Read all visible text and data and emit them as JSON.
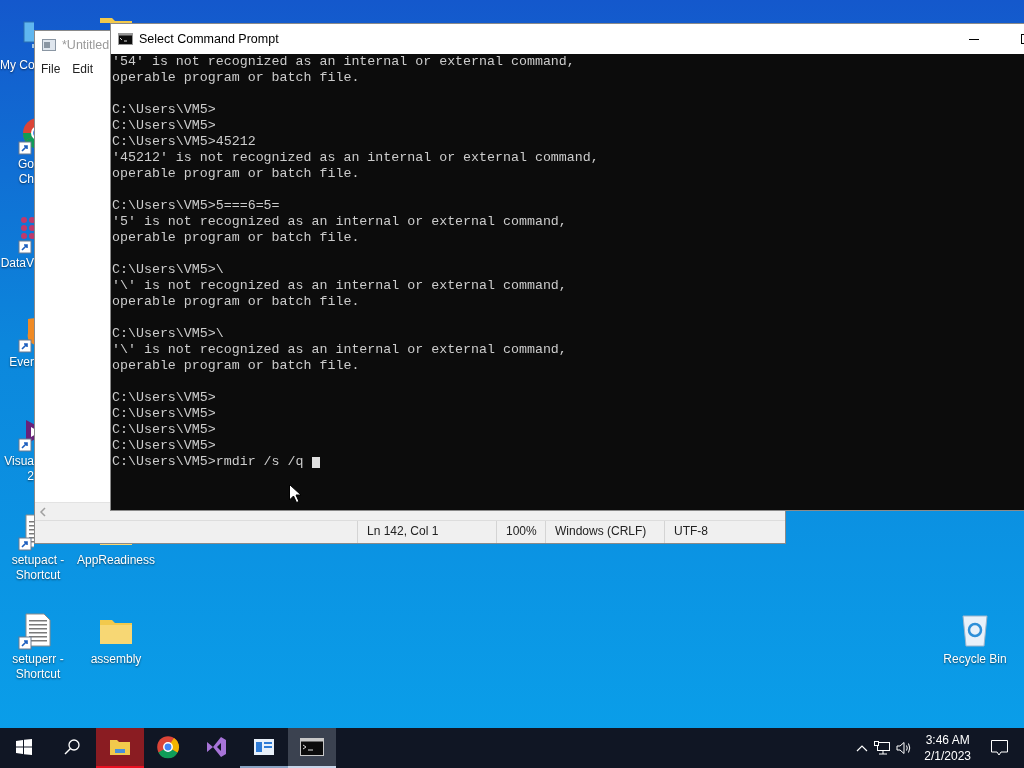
{
  "desktop": {
    "icons": [
      {
        "kind": "computer",
        "shortcut": false,
        "label": [
          "My Co"
        ]
      },
      {
        "kind": "folder"
      },
      {
        "kind": "chrome",
        "shortcut": true,
        "label": [
          "Go",
          "Ch"
        ]
      },
      {
        "kind": "network",
        "shortcut": true,
        "label": [
          "DataV"
        ]
      },
      {
        "kind": "note",
        "shortcut": true,
        "label": [
          "Ever"
        ]
      },
      {
        "kind": "studio",
        "shortcut": true,
        "label": [
          "Visua",
          "2"
        ]
      },
      {
        "kind": "document",
        "shortcut": true,
        "label": [
          "setupact -",
          "Shortcut"
        ]
      },
      {
        "kind": "folder",
        "shortcut": false,
        "label": [
          "AppReadiness"
        ]
      },
      {
        "kind": "document",
        "shortcut": true,
        "label": [
          "setuperr -",
          "Shortcut"
        ]
      },
      {
        "kind": "folder",
        "shortcut": false,
        "label": [
          "assembly"
        ]
      },
      {
        "kind": "recycle",
        "shortcut": false,
        "label": [
          "Recycle Bin"
        ]
      }
    ]
  },
  "notepad": {
    "title": "*Untitled",
    "menu": [
      "File",
      "Edit"
    ],
    "status": [
      "Ln 142, Col 1",
      "100%",
      "Windows (CRLF)",
      "UTF-8"
    ]
  },
  "console": {
    "title": "Select Command Prompt",
    "blocks": [
      [
        "'54' is not recognized as an internal or external command,",
        "operable program or batch file."
      ],
      [
        "C:\\Users\\VM5>",
        "C:\\Users\\VM5>",
        "C:\\Users\\VM5>45212",
        "'45212' is not recognized as an internal or external command,",
        "operable program or batch file."
      ],
      [
        "C:\\Users\\VM5>5===6=5=",
        "'5' is not recognized as an internal or external command,",
        "operable program or batch file."
      ],
      [
        "C:\\Users\\VM5>\\",
        "'\\' is not recognized as an internal or external command,",
        "operable program or batch file."
      ],
      [
        "C:\\Users\\VM5>\\",
        "'\\' is not recognized as an internal or external command,",
        "operable program or batch file."
      ],
      [
        "C:\\Users\\VM5>",
        "C:\\Users\\VM5>",
        "C:\\Users\\VM5>",
        "C:\\Users\\VM5>",
        "C:\\Users\\VM5>rmdir /s /q "
      ]
    ]
  },
  "taskbar": {
    "apps": [
      {
        "kind": "explorer",
        "running": true,
        "flashing": true,
        "selected": false
      },
      {
        "kind": "chrome",
        "running": false,
        "flashing": false,
        "selected": false
      },
      {
        "kind": "studio",
        "running": false,
        "flashing": false,
        "selected": false
      },
      {
        "kind": "viewer",
        "running": true,
        "flashing": false,
        "selected": false
      },
      {
        "kind": "console",
        "running": true,
        "flashing": false,
        "selected": true
      }
    ],
    "clock": {
      "time": "3:46 AM",
      "date": "2/1/2023"
    }
  }
}
